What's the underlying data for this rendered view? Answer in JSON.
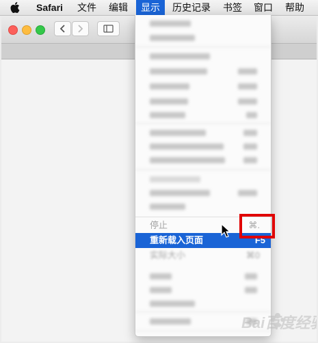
{
  "menubar": {
    "apple_icon": "apple-icon",
    "app_name": "Safari",
    "items": [
      "文件",
      "编辑",
      "显示",
      "历史记录",
      "书签",
      "窗口",
      "帮助"
    ],
    "active_item": "显示"
  },
  "window": {
    "traffic_lights": [
      "#fc605b",
      "#fdbc40",
      "#34c84a"
    ],
    "icons": [
      "chevron-left-icon",
      "chevron-right-icon",
      "sidebar-icon"
    ]
  },
  "view_menu": {
    "stop": {
      "label": "停止",
      "shortcut": "⌘."
    },
    "reload": {
      "label": "重新载入页面",
      "shortcut": "F5"
    },
    "actual_size": {
      "label": "实际大小",
      "shortcut": "⌘0"
    }
  },
  "colors": {
    "highlight": "#1a64d6",
    "callout": "#e00000"
  },
  "watermark": "Bai百度经验"
}
